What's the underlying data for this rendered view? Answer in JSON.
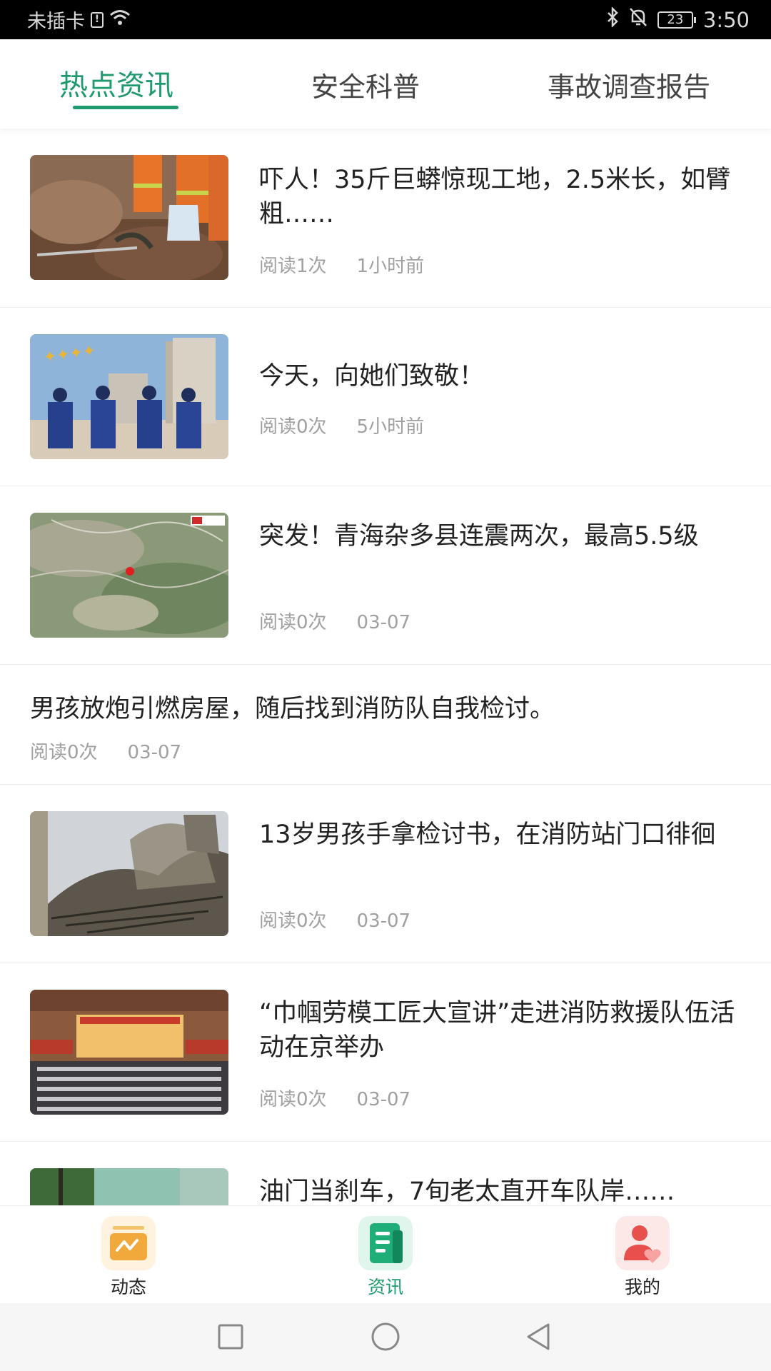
{
  "status_bar": {
    "carrier": "未插卡",
    "sim_glyph": "!",
    "battery_level": "23",
    "time": "3:50"
  },
  "tabs": [
    {
      "label": "热点资讯",
      "active": true
    },
    {
      "label": "安全科普",
      "active": false
    },
    {
      "label": "事故调查报告",
      "active": false
    }
  ],
  "accent_color": "#1e9a6c",
  "news": [
    {
      "title": "吓人！35斤巨蟒惊现工地，2.5米长，如臂粗……",
      "reads": "阅读1次",
      "time": "1小时前",
      "thumbnail": "python-rescue-photo"
    },
    {
      "title": "今天，向她们致敬！",
      "reads": "阅读0次",
      "time": "5小时前",
      "thumbnail": "firefighters-women-photo"
    },
    {
      "title": "突发！青海杂多县连震两次，最高5.5级",
      "reads": "阅读0次",
      "time": "03-07",
      "thumbnail": "earthquake-map-photo"
    },
    {
      "title": "男孩放炮引燃房屋，随后找到消防队自我检讨。",
      "reads": "阅读0次",
      "time": "03-07",
      "thumbnail": null
    },
    {
      "title": "13岁男孩手拿检讨书，在消防站门口徘徊",
      "reads": "阅读0次",
      "time": "03-07",
      "thumbnail": "burned-house-photo"
    },
    {
      "title": "“巾帼劳模工匠大宣讲”走进消防救援队伍活动在京举办",
      "reads": "阅读0次",
      "time": "03-07",
      "thumbnail": "auditorium-photo"
    },
    {
      "title": "油门当刹车，7旬老太直开车队岸……",
      "reads": "",
      "time": "",
      "thumbnail": "trees-photo"
    }
  ],
  "bottom_nav": [
    {
      "label": "动态",
      "icon": "activity-icon",
      "active": false
    },
    {
      "label": "资讯",
      "icon": "news-icon",
      "active": true
    },
    {
      "label": "我的",
      "icon": "profile-icon",
      "active": false
    }
  ],
  "system_nav": [
    "recent-apps-button",
    "home-button",
    "back-button"
  ]
}
